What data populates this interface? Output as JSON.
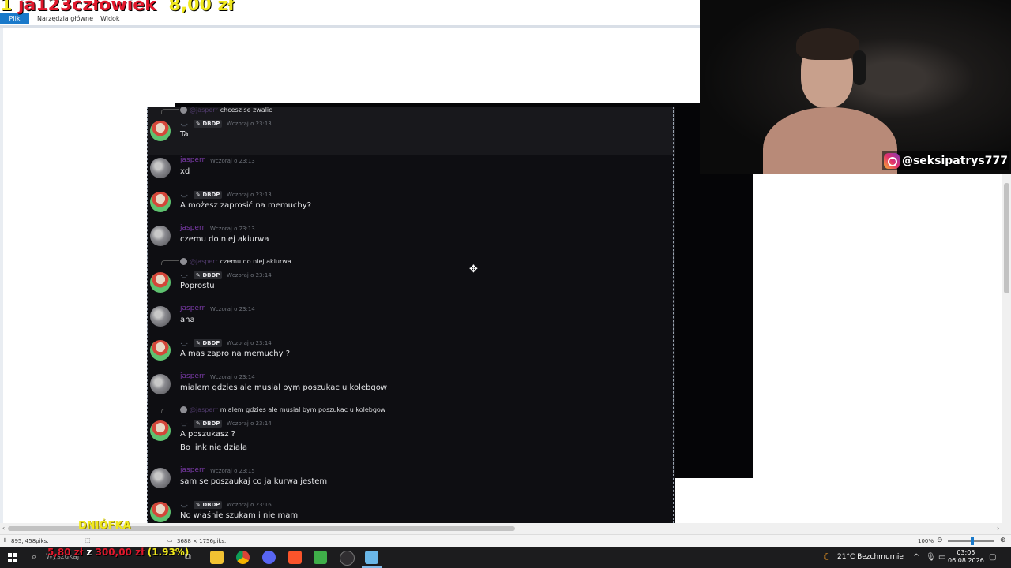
{
  "paint": {
    "tabs": {
      "file": "Plik",
      "home": "Narzędzia główne",
      "view": "Widok"
    },
    "status": {
      "cursor_coords": "895, 458piks.",
      "image_size": "3688 × 1756piks.",
      "zoom": "100%"
    }
  },
  "overlays": {
    "donor_name": "ja123człowiek",
    "donor_amount": "8,00 zł",
    "dniowka": "DNIÓFKA",
    "goal": {
      "current": "5,80 zł",
      "separator": "z",
      "target": "300,00 zł",
      "percent": "(1.93%)"
    }
  },
  "webcam": {
    "instagram_handle": "@seksipatrys777"
  },
  "discord": {
    "messages": [
      {
        "type": "reply",
        "reply_to_name": "@jasperr",
        "reply_text": "chcesz se zwalic",
        "author": "._.",
        "badge": "DBDP",
        "time": "Wczoraj o 23:13",
        "lines": [
          "Ta"
        ],
        "avatar": "green",
        "highlight": true
      },
      {
        "type": "msg",
        "author": "jasperr",
        "time": "Wczoraj o 23:13",
        "lines": [
          "xd"
        ],
        "avatar": "grey"
      },
      {
        "type": "msg",
        "author": "._.",
        "badge": "DBDP",
        "time": "Wczoraj o 23:13",
        "lines": [
          "A możesz zaprosić na memuchy?"
        ],
        "avatar": "green"
      },
      {
        "type": "msg",
        "author": "jasperr",
        "time": "Wczoraj o 23:13",
        "lines": [
          "czemu do niej akiurwa"
        ],
        "avatar": "grey"
      },
      {
        "type": "reply",
        "reply_to_name": "@jasperr",
        "reply_text": "czemu do niej akiurwa",
        "author": "._.",
        "badge": "DBDP",
        "time": "Wczoraj o 23:14",
        "lines": [
          "Poprostu"
        ],
        "avatar": "green"
      },
      {
        "type": "msg",
        "author": "jasperr",
        "time": "Wczoraj o 23:14",
        "lines": [
          "aha"
        ],
        "avatar": "grey"
      },
      {
        "type": "msg",
        "author": "._.",
        "badge": "DBDP",
        "time": "Wczoraj o 23:14",
        "lines": [
          "A mas zapro na memuchy ?"
        ],
        "avatar": "green"
      },
      {
        "type": "msg",
        "author": "jasperr",
        "time": "Wczoraj o 23:14",
        "lines": [
          "mialem gdzies ale musial bym poszukac u kolebgow"
        ],
        "avatar": "grey"
      },
      {
        "type": "reply",
        "reply_to_name": "@jasperr",
        "reply_text": "mialem gdzies ale musial bym poszukac u kolebgow",
        "author": "._.",
        "badge": "DBDP",
        "time": "Wczoraj o 23:14",
        "lines": [
          "A poszukasz ?",
          "Bo link nie działa"
        ],
        "avatar": "green"
      },
      {
        "type": "msg",
        "author": "jasperr",
        "time": "Wczoraj o 23:15",
        "lines": [
          "sam se poszaukaj co ja kurwa jestem"
        ],
        "avatar": "grey"
      },
      {
        "type": "msg",
        "author": "._.",
        "badge": "DBDP",
        "time": "Wczoraj o 23:16",
        "lines": [
          "No właśnie szukam i nie mam"
        ],
        "avatar": "green"
      }
    ]
  },
  "taskbar": {
    "search_placeholder": "Wyszukaj",
    "weather": "21°C  Bezchmurnie",
    "time": "03:05",
    "date": "06.08.2026"
  },
  "colors": {
    "donor_red": "#e0182c",
    "donor_yellow": "#f0e81c",
    "discord_bg": "#0e0e12",
    "accent_blue": "#1979ca"
  }
}
